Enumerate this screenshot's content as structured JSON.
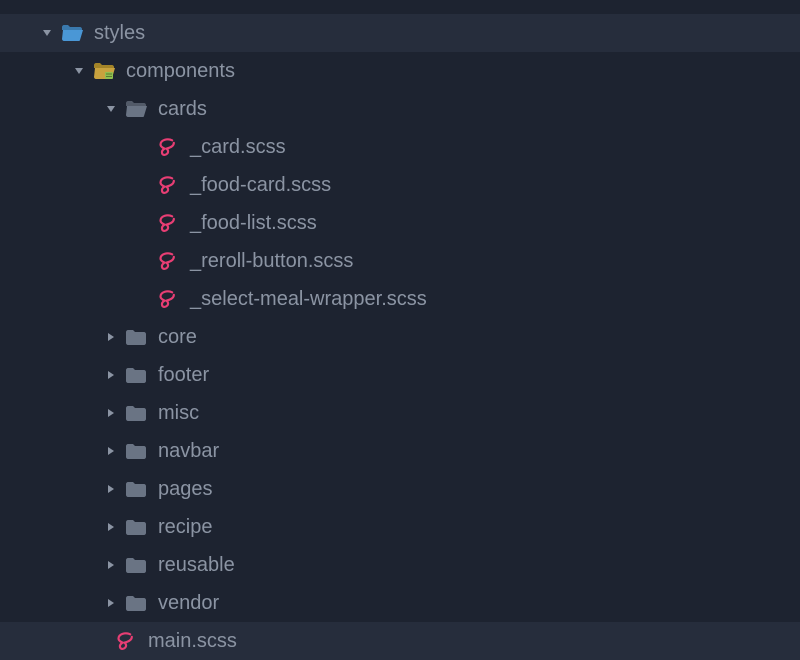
{
  "colors": {
    "bg": "#1d2330",
    "highlight": "#262d3c",
    "text": "#8b94a3",
    "folder_open_styles": "#4a97d6",
    "folder_open_components": "#c8a23e",
    "folder_collapsed": "#6a7484",
    "sass": "#e83e74"
  },
  "tree": {
    "styles": {
      "label": "styles",
      "expanded": true,
      "children": {
        "components": {
          "label": "components",
          "expanded": true,
          "children": {
            "cards": {
              "label": "cards",
              "expanded": true,
              "files": [
                {
                  "label": "_card.scss"
                },
                {
                  "label": "_food-card.scss"
                },
                {
                  "label": "_food-list.scss"
                },
                {
                  "label": "_reroll-button.scss"
                },
                {
                  "label": "_select-meal-wrapper.scss"
                }
              ]
            },
            "core": {
              "label": "core",
              "expanded": false
            },
            "footer": {
              "label": "footer",
              "expanded": false
            },
            "misc": {
              "label": "misc",
              "expanded": false
            },
            "navbar": {
              "label": "navbar",
              "expanded": false
            },
            "pages": {
              "label": "pages",
              "expanded": false
            },
            "recipe": {
              "label": "recipe",
              "expanded": false
            },
            "reusable": {
              "label": "reusable",
              "expanded": false
            },
            "vendor": {
              "label": "vendor",
              "expanded": false
            }
          }
        },
        "main_scss": {
          "label": "main.scss"
        }
      }
    }
  }
}
